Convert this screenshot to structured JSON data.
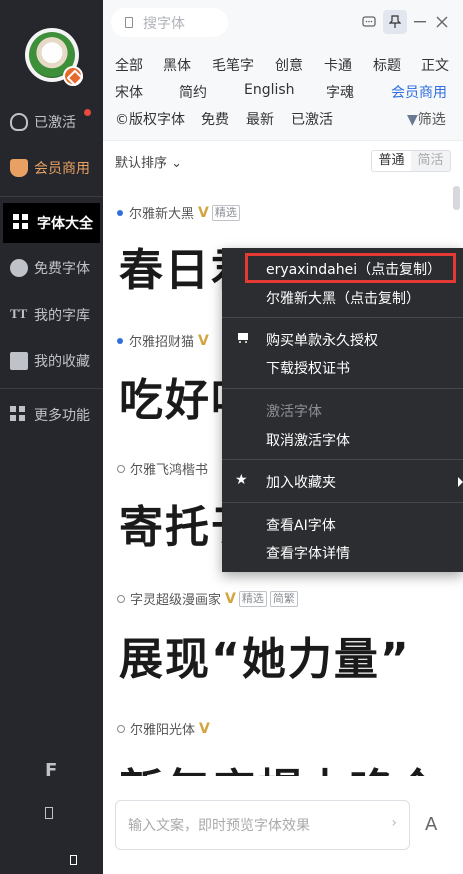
{
  "search": {
    "placeholder": "搜字体"
  },
  "sidebar": {
    "items": [
      {
        "label": "已激活"
      },
      {
        "label": "会员商用"
      },
      {
        "label": "字体大全"
      },
      {
        "label": "免费字体"
      },
      {
        "label": "我的字库"
      },
      {
        "label": "我的收藏"
      },
      {
        "label": "更多功能"
      }
    ]
  },
  "categories": {
    "row1": [
      "全部",
      "黑体",
      "毛笔字",
      "创意",
      "卡通",
      "标题",
      "正文"
    ],
    "row2": [
      "宋体",
      "简约",
      "English",
      "字魂",
      "会员商用"
    ],
    "row3": [
      "©版权字体",
      "免费",
      "最新",
      "已激活"
    ],
    "filter_label": "筛选"
  },
  "sort": {
    "label": "默认排序 ⌄",
    "seg_normal": "普通",
    "seg_traditional": "简活"
  },
  "fonts": [
    {
      "name": "尔雅新大黑",
      "tag1": "精选",
      "tag2": "",
      "preview": "春日君"
    },
    {
      "name": "尔雅招财猫",
      "tag1": "",
      "tag2": "",
      "preview": "吃好吃"
    },
    {
      "name": "尔雅飞鸿楷书",
      "tag1": "",
      "tag2": "",
      "preview": "寄托于"
    },
    {
      "name": "字灵超级漫画家",
      "tag1": "精选",
      "tag2": "简繁",
      "preview": "展现“她力量”"
    },
    {
      "name": "尔雅阳光体",
      "tag1": "",
      "tag2": "",
      "preview": "新年店帽山咯个"
    }
  ],
  "context_menu": {
    "copy_en": "eryaxindahei（点击复制）",
    "copy_cn": "尔雅新大黑（点击复制）",
    "buy_license": "购买单款永久授权",
    "download_cert": "下载授权证书",
    "activate": "激活字体",
    "deactivate": "取消激活字体",
    "add_fav": "加入收藏夹",
    "view_ai": "查看AI字体",
    "view_detail": "查看字体详情"
  },
  "bottom": {
    "placeholder": "输入文案，即时预览字体效果",
    "font_btn": "A"
  }
}
